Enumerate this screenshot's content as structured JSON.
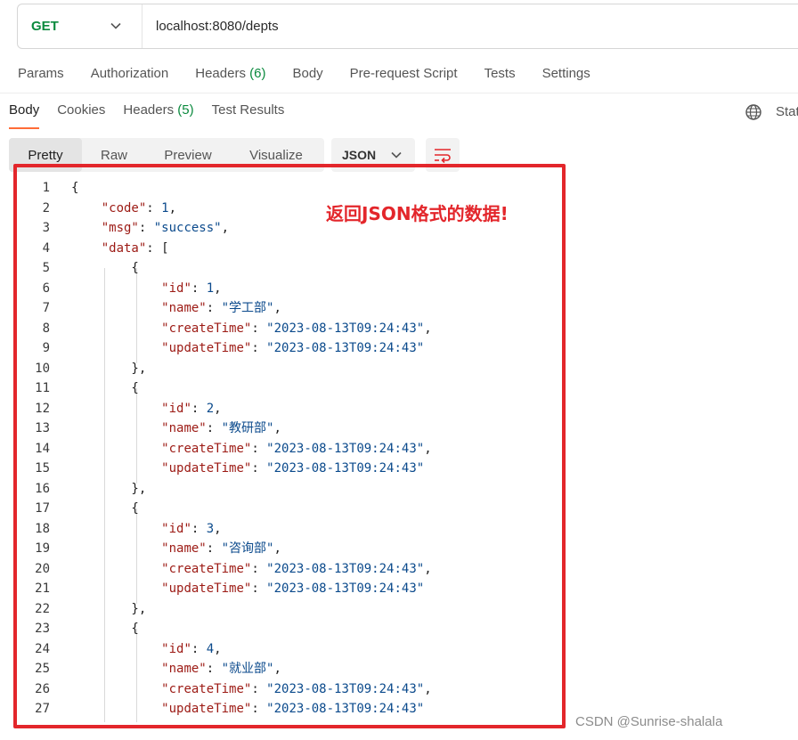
{
  "request": {
    "method": "GET",
    "url": "localhost:8080/depts"
  },
  "request_tabs": [
    {
      "label": "Params"
    },
    {
      "label": "Authorization"
    },
    {
      "label": "Headers",
      "count": "(6)"
    },
    {
      "label": "Body"
    },
    {
      "label": "Pre-request Script"
    },
    {
      "label": "Tests"
    },
    {
      "label": "Settings"
    }
  ],
  "response_tabs": [
    {
      "label": "Body",
      "active": true
    },
    {
      "label": "Cookies"
    },
    {
      "label": "Headers",
      "count": "(5)"
    },
    {
      "label": "Test Results"
    }
  ],
  "status_label": "Stat",
  "view_modes": [
    {
      "label": "Pretty",
      "active": true
    },
    {
      "label": "Raw"
    },
    {
      "label": "Preview"
    },
    {
      "label": "Visualize"
    }
  ],
  "format": "JSON",
  "annotation": "返回JSON格式的数据!",
  "watermark": "CSDN @Sunrise-shalala",
  "icons": {
    "method_dropdown": "chevron-down-icon",
    "format_dropdown": "chevron-down-icon",
    "wrap": "wrap-lines-icon",
    "globe": "globe-icon"
  },
  "colors": {
    "method_get": "#0b8a3e",
    "tab_accent": "#ff6c37",
    "json_key": "#9c1a14",
    "json_value": "#0b4a8c",
    "annotation_red": "#e3262b"
  },
  "code_lines": [
    {
      "n": "1",
      "parts": [
        [
          "p",
          "{"
        ]
      ]
    },
    {
      "n": "2",
      "parts": [
        [
          "p",
          "    "
        ],
        [
          "k",
          "\"code\""
        ],
        [
          "p",
          ": "
        ],
        [
          "n",
          "1"
        ],
        [
          "p",
          ","
        ]
      ]
    },
    {
      "n": "3",
      "parts": [
        [
          "p",
          "    "
        ],
        [
          "k",
          "\"msg\""
        ],
        [
          "p",
          ": "
        ],
        [
          "s",
          "\"success\""
        ],
        [
          "p",
          ","
        ]
      ]
    },
    {
      "n": "4",
      "parts": [
        [
          "p",
          "    "
        ],
        [
          "k",
          "\"data\""
        ],
        [
          "p",
          ": ["
        ]
      ]
    },
    {
      "n": "5",
      "parts": [
        [
          "p",
          "        {"
        ]
      ]
    },
    {
      "n": "6",
      "parts": [
        [
          "p",
          "            "
        ],
        [
          "k",
          "\"id\""
        ],
        [
          "p",
          ": "
        ],
        [
          "n",
          "1"
        ],
        [
          "p",
          ","
        ]
      ]
    },
    {
      "n": "7",
      "parts": [
        [
          "p",
          "            "
        ],
        [
          "k",
          "\"name\""
        ],
        [
          "p",
          ": "
        ],
        [
          "s",
          "\"学工部\""
        ],
        [
          "p",
          ","
        ]
      ]
    },
    {
      "n": "8",
      "parts": [
        [
          "p",
          "            "
        ],
        [
          "k",
          "\"createTime\""
        ],
        [
          "p",
          ": "
        ],
        [
          "s",
          "\"2023-08-13T09:24:43\""
        ],
        [
          "p",
          ","
        ]
      ]
    },
    {
      "n": "9",
      "parts": [
        [
          "p",
          "            "
        ],
        [
          "k",
          "\"updateTime\""
        ],
        [
          "p",
          ": "
        ],
        [
          "s",
          "\"2023-08-13T09:24:43\""
        ]
      ]
    },
    {
      "n": "10",
      "parts": [
        [
          "p",
          "        },"
        ]
      ]
    },
    {
      "n": "11",
      "parts": [
        [
          "p",
          "        {"
        ]
      ]
    },
    {
      "n": "12",
      "parts": [
        [
          "p",
          "            "
        ],
        [
          "k",
          "\"id\""
        ],
        [
          "p",
          ": "
        ],
        [
          "n",
          "2"
        ],
        [
          "p",
          ","
        ]
      ]
    },
    {
      "n": "13",
      "parts": [
        [
          "p",
          "            "
        ],
        [
          "k",
          "\"name\""
        ],
        [
          "p",
          ": "
        ],
        [
          "s",
          "\"教研部\""
        ],
        [
          "p",
          ","
        ]
      ]
    },
    {
      "n": "14",
      "parts": [
        [
          "p",
          "            "
        ],
        [
          "k",
          "\"createTime\""
        ],
        [
          "p",
          ": "
        ],
        [
          "s",
          "\"2023-08-13T09:24:43\""
        ],
        [
          "p",
          ","
        ]
      ]
    },
    {
      "n": "15",
      "parts": [
        [
          "p",
          "            "
        ],
        [
          "k",
          "\"updateTime\""
        ],
        [
          "p",
          ": "
        ],
        [
          "s",
          "\"2023-08-13T09:24:43\""
        ]
      ]
    },
    {
      "n": "16",
      "parts": [
        [
          "p",
          "        },"
        ]
      ]
    },
    {
      "n": "17",
      "parts": [
        [
          "p",
          "        {"
        ]
      ]
    },
    {
      "n": "18",
      "parts": [
        [
          "p",
          "            "
        ],
        [
          "k",
          "\"id\""
        ],
        [
          "p",
          ": "
        ],
        [
          "n",
          "3"
        ],
        [
          "p",
          ","
        ]
      ]
    },
    {
      "n": "19",
      "parts": [
        [
          "p",
          "            "
        ],
        [
          "k",
          "\"name\""
        ],
        [
          "p",
          ": "
        ],
        [
          "s",
          "\"咨询部\""
        ],
        [
          "p",
          ","
        ]
      ]
    },
    {
      "n": "20",
      "parts": [
        [
          "p",
          "            "
        ],
        [
          "k",
          "\"createTime\""
        ],
        [
          "p",
          ": "
        ],
        [
          "s",
          "\"2023-08-13T09:24:43\""
        ],
        [
          "p",
          ","
        ]
      ]
    },
    {
      "n": "21",
      "parts": [
        [
          "p",
          "            "
        ],
        [
          "k",
          "\"updateTime\""
        ],
        [
          "p",
          ": "
        ],
        [
          "s",
          "\"2023-08-13T09:24:43\""
        ]
      ]
    },
    {
      "n": "22",
      "parts": [
        [
          "p",
          "        },"
        ]
      ]
    },
    {
      "n": "23",
      "parts": [
        [
          "p",
          "        {"
        ]
      ]
    },
    {
      "n": "24",
      "parts": [
        [
          "p",
          "            "
        ],
        [
          "k",
          "\"id\""
        ],
        [
          "p",
          ": "
        ],
        [
          "n",
          "4"
        ],
        [
          "p",
          ","
        ]
      ]
    },
    {
      "n": "25",
      "parts": [
        [
          "p",
          "            "
        ],
        [
          "k",
          "\"name\""
        ],
        [
          "p",
          ": "
        ],
        [
          "s",
          "\"就业部\""
        ],
        [
          "p",
          ","
        ]
      ]
    },
    {
      "n": "26",
      "parts": [
        [
          "p",
          "            "
        ],
        [
          "k",
          "\"createTime\""
        ],
        [
          "p",
          ": "
        ],
        [
          "s",
          "\"2023-08-13T09:24:43\""
        ],
        [
          "p",
          ","
        ]
      ]
    },
    {
      "n": "27",
      "parts": [
        [
          "p",
          "            "
        ],
        [
          "k",
          "\"updateTime\""
        ],
        [
          "p",
          ": "
        ],
        [
          "s",
          "\"2023-08-13T09:24:43\""
        ]
      ]
    }
  ]
}
